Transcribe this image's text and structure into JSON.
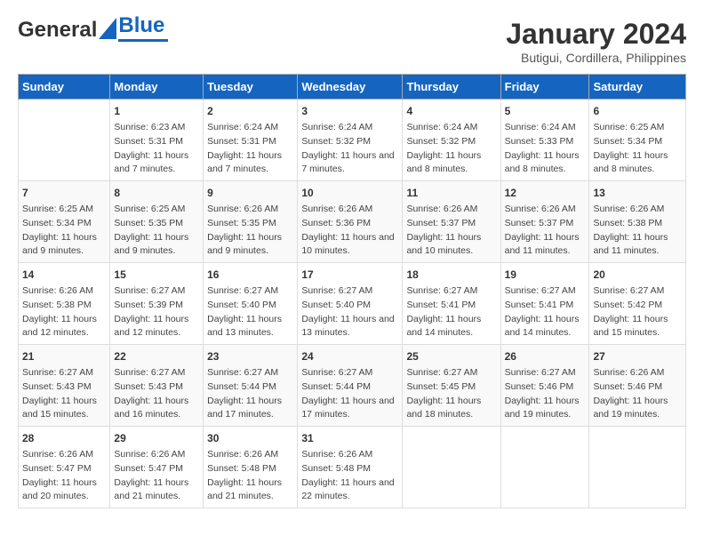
{
  "header": {
    "logo_general": "General",
    "logo_blue": "Blue",
    "title": "January 2024",
    "subtitle": "Butigui, Cordillera, Philippines"
  },
  "weekdays": [
    "Sunday",
    "Monday",
    "Tuesday",
    "Wednesday",
    "Thursday",
    "Friday",
    "Saturday"
  ],
  "weeks": [
    [
      {
        "day": "",
        "sunrise": "",
        "sunset": "",
        "daylight": ""
      },
      {
        "day": "1",
        "sunrise": "Sunrise: 6:23 AM",
        "sunset": "Sunset: 5:31 PM",
        "daylight": "Daylight: 11 hours and 7 minutes."
      },
      {
        "day": "2",
        "sunrise": "Sunrise: 6:24 AM",
        "sunset": "Sunset: 5:31 PM",
        "daylight": "Daylight: 11 hours and 7 minutes."
      },
      {
        "day": "3",
        "sunrise": "Sunrise: 6:24 AM",
        "sunset": "Sunset: 5:32 PM",
        "daylight": "Daylight: 11 hours and 7 minutes."
      },
      {
        "day": "4",
        "sunrise": "Sunrise: 6:24 AM",
        "sunset": "Sunset: 5:32 PM",
        "daylight": "Daylight: 11 hours and 8 minutes."
      },
      {
        "day": "5",
        "sunrise": "Sunrise: 6:24 AM",
        "sunset": "Sunset: 5:33 PM",
        "daylight": "Daylight: 11 hours and 8 minutes."
      },
      {
        "day": "6",
        "sunrise": "Sunrise: 6:25 AM",
        "sunset": "Sunset: 5:34 PM",
        "daylight": "Daylight: 11 hours and 8 minutes."
      }
    ],
    [
      {
        "day": "7",
        "sunrise": "Sunrise: 6:25 AM",
        "sunset": "Sunset: 5:34 PM",
        "daylight": "Daylight: 11 hours and 9 minutes."
      },
      {
        "day": "8",
        "sunrise": "Sunrise: 6:25 AM",
        "sunset": "Sunset: 5:35 PM",
        "daylight": "Daylight: 11 hours and 9 minutes."
      },
      {
        "day": "9",
        "sunrise": "Sunrise: 6:26 AM",
        "sunset": "Sunset: 5:35 PM",
        "daylight": "Daylight: 11 hours and 9 minutes."
      },
      {
        "day": "10",
        "sunrise": "Sunrise: 6:26 AM",
        "sunset": "Sunset: 5:36 PM",
        "daylight": "Daylight: 11 hours and 10 minutes."
      },
      {
        "day": "11",
        "sunrise": "Sunrise: 6:26 AM",
        "sunset": "Sunset: 5:37 PM",
        "daylight": "Daylight: 11 hours and 10 minutes."
      },
      {
        "day": "12",
        "sunrise": "Sunrise: 6:26 AM",
        "sunset": "Sunset: 5:37 PM",
        "daylight": "Daylight: 11 hours and 11 minutes."
      },
      {
        "day": "13",
        "sunrise": "Sunrise: 6:26 AM",
        "sunset": "Sunset: 5:38 PM",
        "daylight": "Daylight: 11 hours and 11 minutes."
      }
    ],
    [
      {
        "day": "14",
        "sunrise": "Sunrise: 6:26 AM",
        "sunset": "Sunset: 5:38 PM",
        "daylight": "Daylight: 11 hours and 12 minutes."
      },
      {
        "day": "15",
        "sunrise": "Sunrise: 6:27 AM",
        "sunset": "Sunset: 5:39 PM",
        "daylight": "Daylight: 11 hours and 12 minutes."
      },
      {
        "day": "16",
        "sunrise": "Sunrise: 6:27 AM",
        "sunset": "Sunset: 5:40 PM",
        "daylight": "Daylight: 11 hours and 13 minutes."
      },
      {
        "day": "17",
        "sunrise": "Sunrise: 6:27 AM",
        "sunset": "Sunset: 5:40 PM",
        "daylight": "Daylight: 11 hours and 13 minutes."
      },
      {
        "day": "18",
        "sunrise": "Sunrise: 6:27 AM",
        "sunset": "Sunset: 5:41 PM",
        "daylight": "Daylight: 11 hours and 14 minutes."
      },
      {
        "day": "19",
        "sunrise": "Sunrise: 6:27 AM",
        "sunset": "Sunset: 5:41 PM",
        "daylight": "Daylight: 11 hours and 14 minutes."
      },
      {
        "day": "20",
        "sunrise": "Sunrise: 6:27 AM",
        "sunset": "Sunset: 5:42 PM",
        "daylight": "Daylight: 11 hours and 15 minutes."
      }
    ],
    [
      {
        "day": "21",
        "sunrise": "Sunrise: 6:27 AM",
        "sunset": "Sunset: 5:43 PM",
        "daylight": "Daylight: 11 hours and 15 minutes."
      },
      {
        "day": "22",
        "sunrise": "Sunrise: 6:27 AM",
        "sunset": "Sunset: 5:43 PM",
        "daylight": "Daylight: 11 hours and 16 minutes."
      },
      {
        "day": "23",
        "sunrise": "Sunrise: 6:27 AM",
        "sunset": "Sunset: 5:44 PM",
        "daylight": "Daylight: 11 hours and 17 minutes."
      },
      {
        "day": "24",
        "sunrise": "Sunrise: 6:27 AM",
        "sunset": "Sunset: 5:44 PM",
        "daylight": "Daylight: 11 hours and 17 minutes."
      },
      {
        "day": "25",
        "sunrise": "Sunrise: 6:27 AM",
        "sunset": "Sunset: 5:45 PM",
        "daylight": "Daylight: 11 hours and 18 minutes."
      },
      {
        "day": "26",
        "sunrise": "Sunrise: 6:27 AM",
        "sunset": "Sunset: 5:46 PM",
        "daylight": "Daylight: 11 hours and 19 minutes."
      },
      {
        "day": "27",
        "sunrise": "Sunrise: 6:26 AM",
        "sunset": "Sunset: 5:46 PM",
        "daylight": "Daylight: 11 hours and 19 minutes."
      }
    ],
    [
      {
        "day": "28",
        "sunrise": "Sunrise: 6:26 AM",
        "sunset": "Sunset: 5:47 PM",
        "daylight": "Daylight: 11 hours and 20 minutes."
      },
      {
        "day": "29",
        "sunrise": "Sunrise: 6:26 AM",
        "sunset": "Sunset: 5:47 PM",
        "daylight": "Daylight: 11 hours and 21 minutes."
      },
      {
        "day": "30",
        "sunrise": "Sunrise: 6:26 AM",
        "sunset": "Sunset: 5:48 PM",
        "daylight": "Daylight: 11 hours and 21 minutes."
      },
      {
        "day": "31",
        "sunrise": "Sunrise: 6:26 AM",
        "sunset": "Sunset: 5:48 PM",
        "daylight": "Daylight: 11 hours and 22 minutes."
      },
      {
        "day": "",
        "sunrise": "",
        "sunset": "",
        "daylight": ""
      },
      {
        "day": "",
        "sunrise": "",
        "sunset": "",
        "daylight": ""
      },
      {
        "day": "",
        "sunrise": "",
        "sunset": "",
        "daylight": ""
      }
    ]
  ]
}
